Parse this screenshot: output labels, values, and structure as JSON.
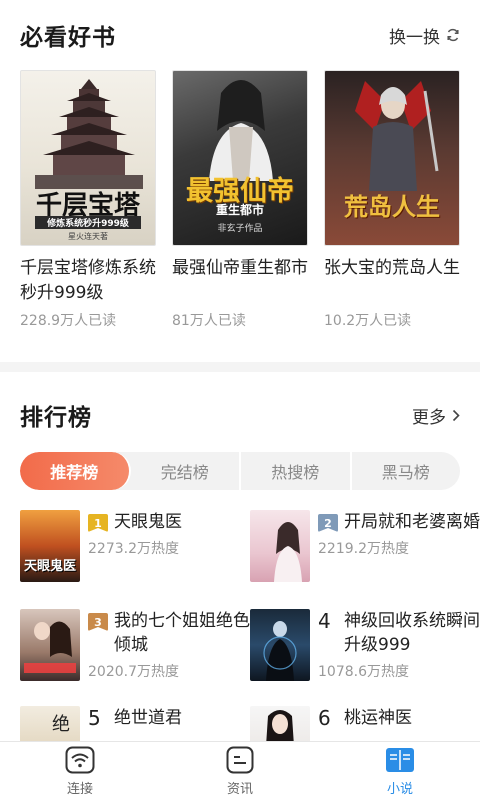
{
  "must_read": {
    "title": "必看好书",
    "refresh_label": "换一换",
    "books": [
      {
        "title": "千层宝塔修炼系统秒升999级",
        "reads": "228.9万人已读",
        "cover_text": "千层宝塔",
        "cover_sub": "修炼系统秒升999级",
        "cover_author": "星火连天著"
      },
      {
        "title": "最强仙帝重生都市",
        "reads": "81万人已读",
        "cover_text": "最强仙帝",
        "cover_sub": "重生都市",
        "cover_author": "非玄子作品"
      },
      {
        "title": "张大宝的荒岛人生",
        "reads": "10.2万人已读",
        "cover_text": "荒岛人生",
        "cover_sub": "",
        "cover_author": ""
      }
    ]
  },
  "ranking": {
    "title": "排行榜",
    "more_label": "更多",
    "tabs": [
      {
        "label": "推荐榜",
        "active": true
      },
      {
        "label": "完结榜",
        "active": false
      },
      {
        "label": "热搜榜",
        "active": false
      },
      {
        "label": "黑马榜",
        "active": false
      }
    ],
    "items": [
      {
        "rank": "1",
        "title": "天眼鬼医",
        "heat": "2273.2万热度"
      },
      {
        "rank": "2",
        "title": "开局就和老婆离婚",
        "heat": "2219.2万热度"
      },
      {
        "rank": "3",
        "title": "我的七个姐姐绝色倾城",
        "heat": "2020.7万热度"
      },
      {
        "rank": "4",
        "title": "神级回收系统瞬间升级999",
        "heat": "1078.6万热度"
      },
      {
        "rank": "5",
        "title": "绝世道君",
        "heat": ""
      },
      {
        "rank": "6",
        "title": "桃运神医",
        "heat": ""
      }
    ]
  },
  "nav": {
    "items": [
      {
        "label": "连接",
        "icon": "wifi-icon",
        "active": false
      },
      {
        "label": "资讯",
        "icon": "news-icon",
        "active": false
      },
      {
        "label": "小说",
        "icon": "book-icon",
        "active": true
      }
    ]
  },
  "colors": {
    "accent": "#f26b4a",
    "nav_active": "#2a8de6",
    "gold": "#e6b422",
    "silver": "#7f9ab8",
    "bronze": "#c98a4a"
  }
}
